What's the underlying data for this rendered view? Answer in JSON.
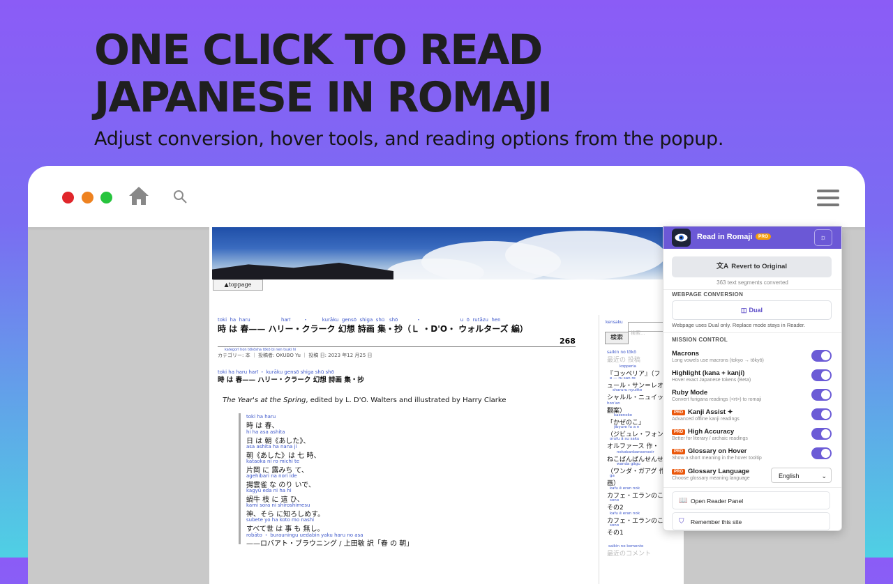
{
  "hero": {
    "title_line1": "ONE CLICK TO READ",
    "title_line2": "JAPANESE IN ROMAJI",
    "subtitle": "Adjust conversion, hover tools, and reading options from the popup."
  },
  "webpage": {
    "toppage_button": "▲toppage",
    "title_ruby": [
      "toki",
      "ha",
      "haru",
      "harī",
      "・",
      "kurāku",
      "gensō",
      "shiga",
      "shū",
      "shō",
      "・",
      "u",
      "ō",
      "rutāzu",
      "hen"
    ],
    "title": "時 は 春—— ハリー・クラーク 幻想 詩画 集・抄（Ｌ ・D'O・ ウォルターズ 編）",
    "post_number": "268",
    "meta_ruby": "kategorī   hon   tōkōsha                    tōkō   bi      nen   tsuki   hi",
    "meta": "カテゴリー: 本 ｜ 投稿者: OKUBO Yu ｜ 投稿 日: 2023 年12 月25 日",
    "subtitle_ruby": "toki  ha  haru          harī   ・   kurāku   gensō  shiga  shū   shō",
    "subtitle": "時 は 春—— ハリー・クラーク 幻想 詩画 集・抄",
    "english_italic": "The Year's at the Spring",
    "english_rest": ", edited by L. D'O. Walters and illustrated by Harry Clarke",
    "poem": [
      {
        "ruby": "toki   ha   haru",
        "text": "時 は 春、"
      },
      {
        "ruby": "hi   ha  asa        ashita",
        "text": "日 は 朝《あした》、"
      },
      {
        "ruby": "asa       ashita       ha  nana  ji",
        "text": "朝《あした》は 七 時、"
      },
      {
        "ruby": "kataoka  ni   ro   michi   te",
        "text": "片岡 に 露みち て、"
      },
      {
        "ruby": "agehibari  na    nori    ide",
        "text": "揚雲雀 な のり いで、"
      },
      {
        "ruby": "kagyū  eda   ni  ha   hi",
        "text": "蝸牛 枝 に 這 ひ、"
      },
      {
        "ruby": "kami        sora    ni    shiroshimesu",
        "text": "神、そら に知ろしめす。"
      },
      {
        "ruby": "subete  yo  ha  koto  mo  nashi",
        "text": "すべて世 は 事 も 無し。"
      },
      {
        "ruby": "robāto      ・      burauningu       uedabin  yaku    haru  no  asa",
        "text": "——ロバアト・ブラウニング / 上田敏 訳「春 の 朝」"
      }
    ],
    "sidebar": {
      "search_label": "kensaku",
      "search_placeholder": "検索...",
      "search_button": "検索",
      "recent_posts_ruby": "saikin  no  tōkō",
      "recent_posts": "最近の 投稿",
      "items": [
        {
          "ruby": "kopperia",
          "text": "『コッペリア』（フ"
        },
        {
          "ruby": "e  —  ru   san    re",
          "text": "ュール・サン＝レオ"
        },
        {
          "ruby": "sharuru    nyuitte",
          "text": "シャルル・ニュイッ"
        },
        {
          "ruby": "hon'an",
          "text": "翻案）"
        },
        {
          "ruby": "kazenoko",
          "text": "「かぜのこ」"
        },
        {
          "ruby": "jibyure      fu  a  n",
          "text": "（ジビュレ・フォン"
        },
        {
          "ruby": "orufu  ā  su  saku",
          "text": "オルファース 作・"
        },
        {
          "ruby": "nekobanbansenseir",
          "text": "ねこばんばんせんせ"
        },
        {
          "ruby": "wanda     gāgu",
          "text": "（ワンダ・ガアグ 作"
        },
        {
          "ruby": "ga",
          "text": "画）"
        },
        {
          "ruby": "kafu   ē    eran   nok",
          "text": "カフェ・エランのこ"
        },
        {
          "ruby": "sono",
          "text": "その2"
        },
        {
          "ruby": "kafu   ē    eran   nok",
          "text": "カフェ・エランのこ"
        },
        {
          "ruby": "sono",
          "text": "その1"
        }
      ],
      "recent_comments_ruby": "saikin   no   komento",
      "recent_comments": "最近のコメント"
    }
  },
  "popup": {
    "app_name": "Read in Romaji",
    "pro_badge": "PRO",
    "revert_button": "Revert to Original",
    "segments_converted": "363 text segments converted",
    "webpage_conversion_label": "WEBPAGE CONVERSION",
    "dual_button": "Dual",
    "dual_note": "Webpage uses Dual only. Replace mode stays in Reader.",
    "mission_control_label": "MISSION CONTROL",
    "options": [
      {
        "pro": false,
        "title": "Macrons",
        "desc": "Long vowels use macrons (tokyo → tōkyō)",
        "on": true
      },
      {
        "pro": false,
        "title": "Highlight (kana + kanji)",
        "desc": "Hover exact Japanese tokens (Beta)",
        "on": true
      },
      {
        "pro": false,
        "title": "Ruby Mode",
        "desc": "Convert furigana readings (<rt>) to romaji",
        "on": true
      },
      {
        "pro": true,
        "title": "Kanji Assist ✦",
        "desc": "Advanced offline kanji readings",
        "on": true
      },
      {
        "pro": true,
        "title": "High Accuracy",
        "desc": "Better for literary / archaic readings",
        "on": true
      },
      {
        "pro": true,
        "title": "Glossary on Hover",
        "desc": "Show a short meaning in the hover tooltip",
        "on": true
      }
    ],
    "pro_tag": "PRO",
    "glossary_language_title": "Glossary Language",
    "glossary_language_desc": "Choose glossary meaning language",
    "glossary_language_value": "English",
    "open_reader_button": "Open Reader Panel",
    "remember_site_button": "Remember this site",
    "colors": {
      "accent": "#6b58d6",
      "pro_orange": "#ea580c",
      "badge": "#f59e0b"
    }
  }
}
